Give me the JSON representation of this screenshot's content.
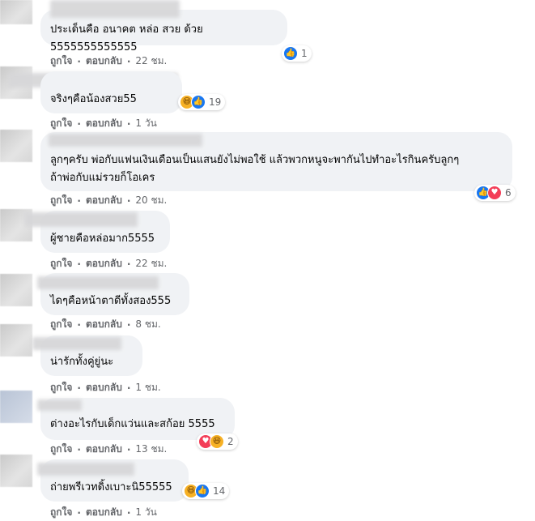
{
  "comments": [
    {
      "text": "ประเด็นคือ อนาคต หล่อ สวย ด้วย 5555555555555",
      "like": "ถูกใจ",
      "reply": "ตอบกลับ",
      "time": "22 ชม.",
      "count": "1"
    },
    {
      "text": "จริงๆคือน้องสวย55",
      "like": "ถูกใจ",
      "reply": "ตอบกลับ",
      "time": "1 วัน",
      "count": "19"
    },
    {
      "text": "ลูกๆครับ พ่อกับแฟนเงินเดือนเป็นแสนยังไม่พอใช้ แล้วพวกหนูจะพากันไปทำอะไรกินครับลูกๆ\nถ้าพ่อกับแม่รวยก็โอเคร",
      "like": "ถูกใจ",
      "reply": "ตอบกลับ",
      "time": "20 ชม.",
      "count": "6"
    },
    {
      "text": "ผู้ชายคือหล่อมาก5555",
      "like": "ถูกใจ",
      "reply": "ตอบกลับ",
      "time": "22 ชม."
    },
    {
      "text": "ไดๆคือหน้าตาดีทั้งสอง555",
      "like": "ถูกใจ",
      "reply": "ตอบกลับ",
      "time": "8 ชม."
    },
    {
      "text": "น่ารักทั้งคู่ยู่นะ",
      "like": "ถูกใจ",
      "reply": "ตอบกลับ",
      "time": "1 ชม."
    },
    {
      "text": "ต่างอะไรกับเด็กแว่นและสก้อย 5555",
      "like": "ถูกใจ",
      "reply": "ตอบกลับ",
      "time": "13 ชม.",
      "count": "2"
    },
    {
      "text": "ถ่ายพรีเวทดิ้งเบาะนิ55555",
      "like": "ถูกใจ",
      "reply": "ตอบกลับ",
      "time": "1 วัน",
      "count": "14"
    }
  ],
  "colors": {
    "bubble": "#f0f2f5",
    "meta": "#65676b",
    "like": "#1877f2",
    "haha": "#f7b125",
    "love": "#f33e58"
  }
}
